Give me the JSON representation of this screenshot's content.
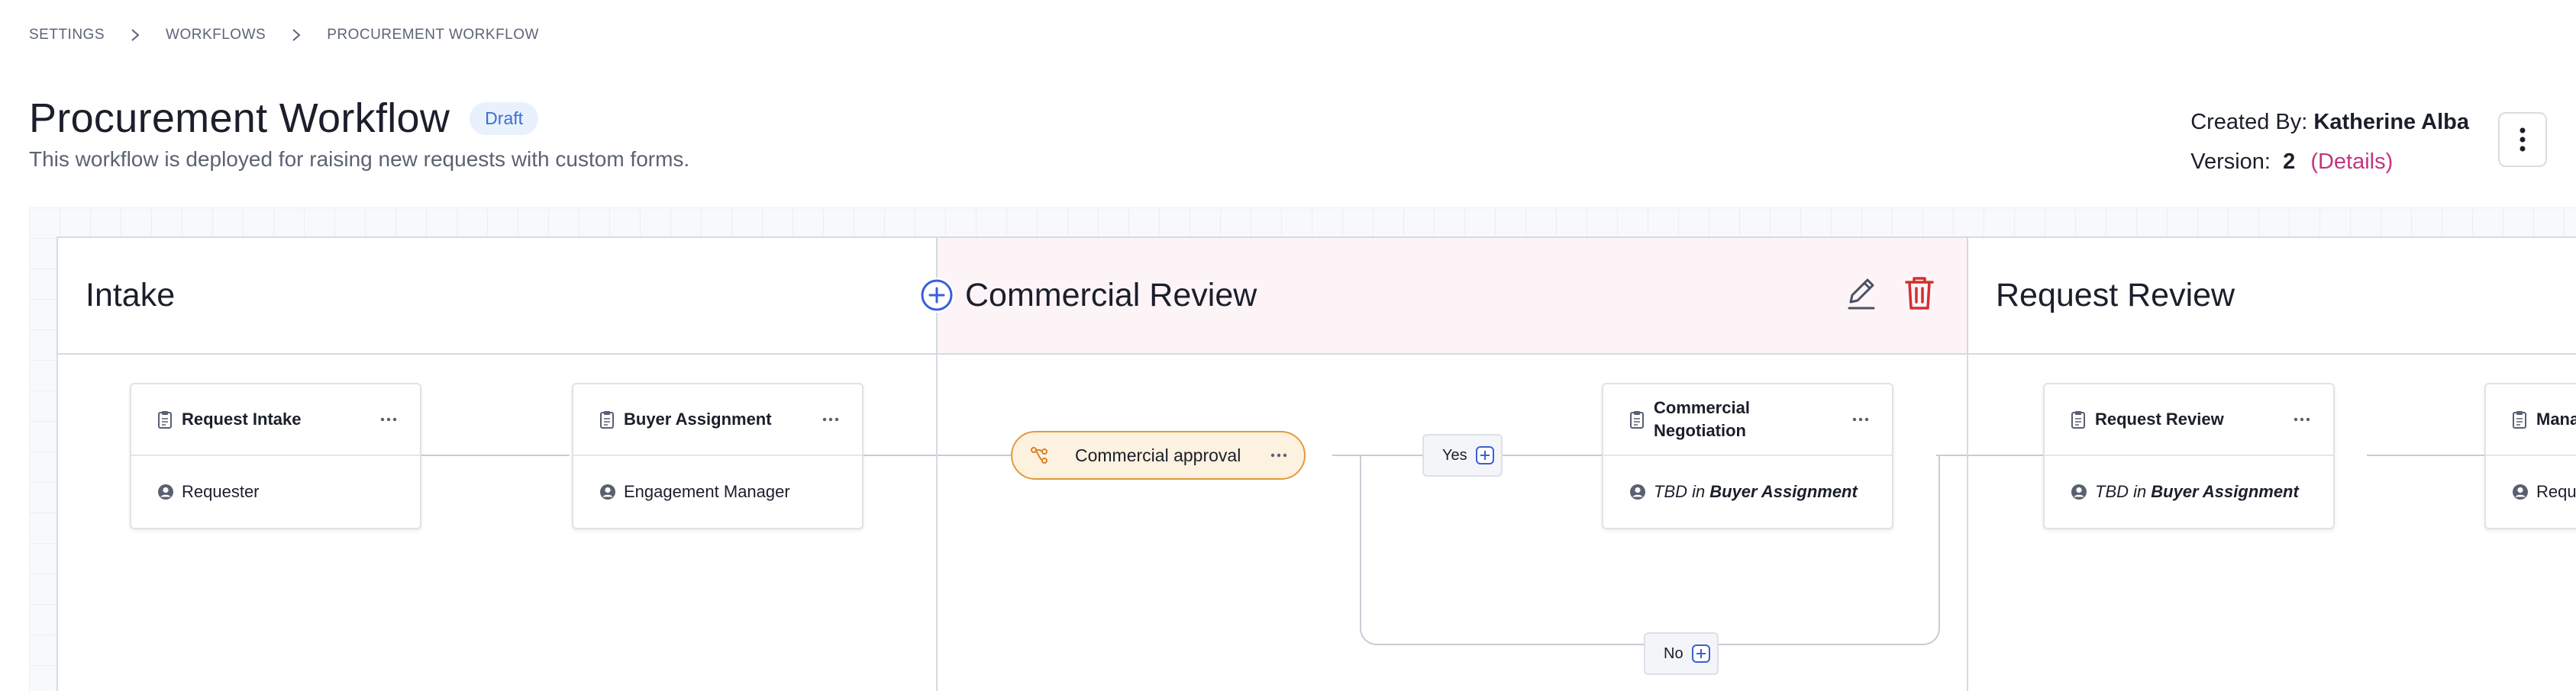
{
  "breadcrumb": [
    "SETTINGS",
    "WORKFLOWS",
    "PROCUREMENT WORKFLOW"
  ],
  "header": {
    "title": "Procurement Workflow",
    "status_badge": "Draft",
    "subtitle": "This workflow is deployed for raising new requests with custom forms.",
    "created_by_label": "Created By:",
    "created_by": "Katherine Alba",
    "version_label": "Version:",
    "version": "2",
    "details_link": "(Details)"
  },
  "stages": [
    {
      "title": "Intake"
    },
    {
      "title": "Commercial Review"
    },
    {
      "title": "Request Review"
    }
  ],
  "cards": {
    "request_intake": {
      "title": "Request Intake",
      "assignee": "Requester"
    },
    "buyer_assignment": {
      "title": "Buyer Assignment",
      "assignee": "Engagement Manager"
    },
    "commercial_negotiation": {
      "title": "Commercial Negotiation",
      "assignee_prefix": "TBD in",
      "assignee_ref": "Buyer Assignment"
    },
    "request_review": {
      "title": "Request Review",
      "assignee_prefix": "TBD in",
      "assignee_ref": "Buyer Assignment"
    },
    "partial": {
      "title": "Mana",
      "assignee": "Requ"
    }
  },
  "condition": {
    "label": "Commercial approval",
    "yes_label": "Yes",
    "no_label": "No"
  },
  "colors": {
    "accent_blue": "#3b5fd6",
    "delete_red": "#d32f2f",
    "condition_orange": "#e29a3a",
    "link_pink": "#c2357f",
    "active_stage_bg": "#fdf4f8"
  },
  "icons": [
    "chevron-right-icon",
    "kebab-menu-icon",
    "add-circle-icon",
    "pencil-icon",
    "trash-icon",
    "clipboard-icon",
    "person-icon",
    "branch-icon",
    "plus-square-icon",
    "ellipsis-icon"
  ]
}
